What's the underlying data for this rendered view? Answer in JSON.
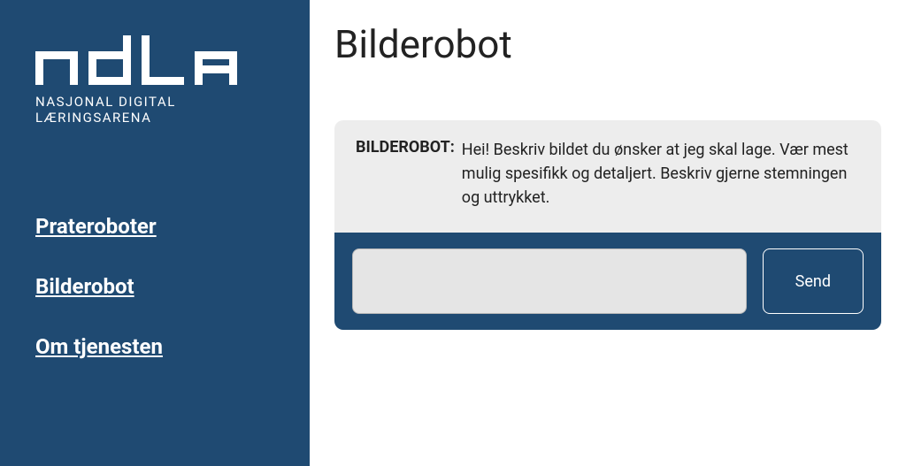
{
  "sidebar": {
    "logo": {
      "tagline": "NASJONAL DIGITAL LÆRINGSARENA"
    },
    "nav": [
      {
        "label": "Prateroboter"
      },
      {
        "label": "Bilderobot"
      },
      {
        "label": "Om tjenesten"
      }
    ]
  },
  "main": {
    "title": "Bilderobot"
  },
  "chat": {
    "author": "BILDEROBOT:",
    "greeting": "Hei! Beskriv bildet du ønsker at jeg skal lage. Vær mest mulig spesifikk og detaljert. Beskriv gjerne stemningen og uttrykket.",
    "input_value": "",
    "send_label": "Send"
  }
}
